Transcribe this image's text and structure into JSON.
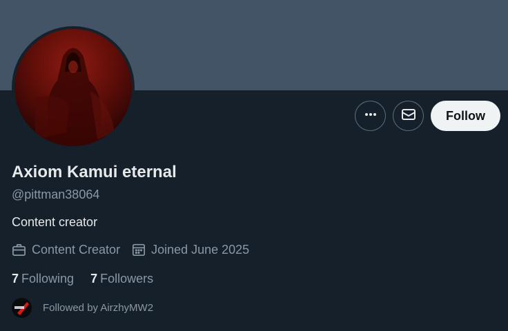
{
  "profile": {
    "display_name": "Axiom Kamui eternal",
    "handle": "@pittman38064",
    "bio": "Content creator",
    "category": "Content Creator",
    "joined": "Joined June 2025"
  },
  "actions": {
    "more_icon": "more-horizontal-icon",
    "message_icon": "mail-icon",
    "follow_label": "Follow"
  },
  "stats": {
    "following_count": "7",
    "following_label": "Following",
    "followers_count": "7",
    "followers_label": "Followers"
  },
  "followed_by": {
    "text": "Followed by AirzhyMW2"
  },
  "colors": {
    "background": "#15202b",
    "banner": "#425466",
    "primary_text": "#e7e9ea",
    "secondary_text": "#8b98a5",
    "follow_button_bg": "#eff3f4"
  }
}
